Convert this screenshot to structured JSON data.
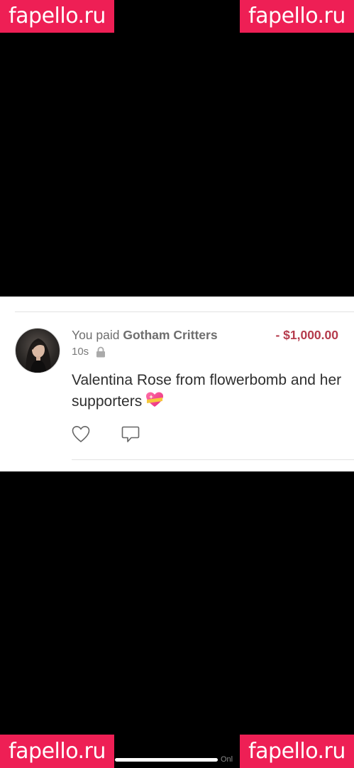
{
  "watermarks": {
    "top_left": "fapello.ru",
    "top_right": "fapello.ru",
    "bottom_left": "fapello.ru",
    "bottom_right": "fapello.ru"
  },
  "transaction": {
    "prefix": "You paid ",
    "payee": "Gotham Critters",
    "amount": "- $1,000.00",
    "time": "10s",
    "privacy_icon": "lock-icon",
    "message": "Valentina Rose from flowerbomb and her supporters",
    "emoji": "sparkling-heart",
    "like_icon": "heart-icon",
    "comment_icon": "comment-icon"
  },
  "footer": {
    "partial_text": "Onl"
  },
  "colors": {
    "watermark_bg": "#ee1f55",
    "amount": "#b53c4d",
    "background": "#000000",
    "card": "#ffffff"
  }
}
